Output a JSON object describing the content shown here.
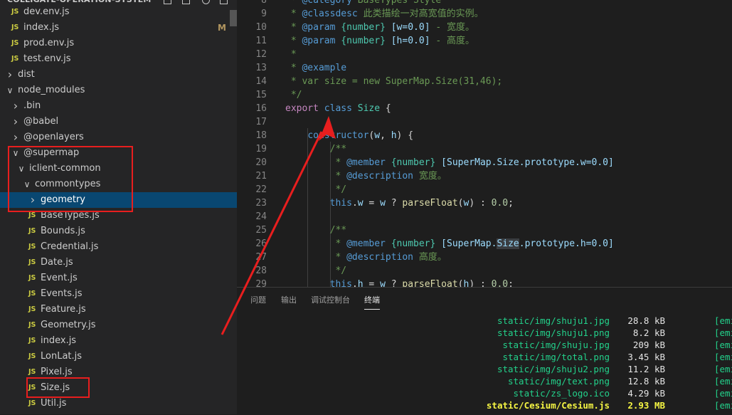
{
  "sidebar": {
    "title": "COLLIGATE-OPERATION-SYSTEM",
    "items": [
      {
        "label": "dev.env.js",
        "type": "file",
        "depth": 1
      },
      {
        "label": "index.js",
        "type": "file",
        "depth": 1,
        "badge": "M"
      },
      {
        "label": "prod.env.js",
        "type": "file",
        "depth": 1
      },
      {
        "label": "test.env.js",
        "type": "file",
        "depth": 1
      },
      {
        "label": "dist",
        "type": "folder",
        "depth": 0,
        "expanded": false
      },
      {
        "label": "node_modules",
        "type": "folder",
        "depth": 0,
        "expanded": true
      },
      {
        "label": ".bin",
        "type": "folder",
        "depth": 1,
        "expanded": false
      },
      {
        "label": "@babel",
        "type": "folder",
        "depth": 1,
        "expanded": false
      },
      {
        "label": "@openlayers",
        "type": "folder",
        "depth": 1,
        "expanded": false
      },
      {
        "label": "@supermap",
        "type": "folder",
        "depth": 1,
        "expanded": true
      },
      {
        "label": "iclient-common",
        "type": "folder",
        "depth": 2,
        "expanded": true
      },
      {
        "label": "commontypes",
        "type": "folder",
        "depth": 3,
        "expanded": true
      },
      {
        "label": "geometry",
        "type": "folder",
        "depth": 4,
        "expanded": false,
        "selected": true
      },
      {
        "label": "BaseTypes.js",
        "type": "file",
        "depth": 4
      },
      {
        "label": "Bounds.js",
        "type": "file",
        "depth": 4
      },
      {
        "label": "Credential.js",
        "type": "file",
        "depth": 4
      },
      {
        "label": "Date.js",
        "type": "file",
        "depth": 4
      },
      {
        "label": "Event.js",
        "type": "file",
        "depth": 4
      },
      {
        "label": "Events.js",
        "type": "file",
        "depth": 4
      },
      {
        "label": "Feature.js",
        "type": "file",
        "depth": 4
      },
      {
        "label": "Geometry.js",
        "type": "file",
        "depth": 4
      },
      {
        "label": "index.js",
        "type": "file",
        "depth": 4
      },
      {
        "label": "LonLat.js",
        "type": "file",
        "depth": 4
      },
      {
        "label": "Pixel.js",
        "type": "file",
        "depth": 4
      },
      {
        "label": "Size.js",
        "type": "file",
        "depth": 4
      },
      {
        "label": "Util.js",
        "type": "file",
        "depth": 4
      }
    ]
  },
  "editor": {
    "lines": [
      {
        "n": "8",
        "tokens": [
          [
            " * ",
            "com"
          ],
          [
            "@category",
            "tag"
          ],
          [
            " BaseTypes Style",
            "com"
          ]
        ]
      },
      {
        "n": "9",
        "tokens": [
          [
            " * ",
            "com"
          ],
          [
            "@classdesc",
            "tag"
          ],
          [
            " 此类描绘一对高宽值的实例。",
            "com"
          ]
        ]
      },
      {
        "n": "10",
        "tokens": [
          [
            " * ",
            "com"
          ],
          [
            "@param",
            "tag"
          ],
          [
            " ",
            "com"
          ],
          [
            "{number}",
            "type"
          ],
          [
            " ",
            "com"
          ],
          [
            "[w=0.0]",
            "var"
          ],
          [
            " - 宽度。",
            "com"
          ]
        ]
      },
      {
        "n": "11",
        "tokens": [
          [
            " * ",
            "com"
          ],
          [
            "@param",
            "tag"
          ],
          [
            " ",
            "com"
          ],
          [
            "{number}",
            "type"
          ],
          [
            " ",
            "com"
          ],
          [
            "[h=0.0]",
            "var"
          ],
          [
            " - 高度。",
            "com"
          ]
        ]
      },
      {
        "n": "12",
        "tokens": [
          [
            " *",
            "com"
          ]
        ]
      },
      {
        "n": "13",
        "tokens": [
          [
            " * ",
            "com"
          ],
          [
            "@example",
            "tag"
          ]
        ]
      },
      {
        "n": "14",
        "tokens": [
          [
            " * var size = new SuperMap.Size(31,46);",
            "com"
          ]
        ]
      },
      {
        "n": "15",
        "tokens": [
          [
            " */",
            "com"
          ]
        ]
      },
      {
        "n": "16",
        "tokens": [
          [
            "export",
            "kw"
          ],
          [
            " ",
            "plain"
          ],
          [
            "class",
            "tag"
          ],
          [
            " ",
            "plain"
          ],
          [
            "Size",
            "class"
          ],
          [
            " {",
            "plain"
          ]
        ]
      },
      {
        "n": "17",
        "tokens": []
      },
      {
        "n": "18",
        "tokens": [
          [
            "    ",
            "plain"
          ],
          [
            "constructor",
            "tag"
          ],
          [
            "(",
            "plain"
          ],
          [
            "w",
            "var"
          ],
          [
            ", ",
            "plain"
          ],
          [
            "h",
            "var"
          ],
          [
            ") {",
            "plain"
          ]
        ]
      },
      {
        "n": "19",
        "tokens": [
          [
            "        /**",
            "com"
          ]
        ]
      },
      {
        "n": "20",
        "tokens": [
          [
            "         * ",
            "com"
          ],
          [
            "@member",
            "tag"
          ],
          [
            " ",
            "com"
          ],
          [
            "{number}",
            "type"
          ],
          [
            " ",
            "com"
          ],
          [
            "[SuperMap.Size.prototype.w=0.0]",
            "var"
          ]
        ]
      },
      {
        "n": "21",
        "tokens": [
          [
            "         * ",
            "com"
          ],
          [
            "@description",
            "tag"
          ],
          [
            " 宽度。",
            "com"
          ]
        ]
      },
      {
        "n": "22",
        "tokens": [
          [
            "         */",
            "com"
          ]
        ]
      },
      {
        "n": "23",
        "tokens": [
          [
            "        ",
            "plain"
          ],
          [
            "this",
            "tag"
          ],
          [
            ".",
            "plain"
          ],
          [
            "w",
            "var"
          ],
          [
            " = ",
            "plain"
          ],
          [
            "w",
            "var"
          ],
          [
            " ? ",
            "plain"
          ],
          [
            "parseFloat",
            "fn"
          ],
          [
            "(",
            "plain"
          ],
          [
            "w",
            "var"
          ],
          [
            ") : ",
            "plain"
          ],
          [
            "0.0",
            "num"
          ],
          [
            ";",
            "plain"
          ]
        ]
      },
      {
        "n": "24",
        "tokens": []
      },
      {
        "n": "25",
        "tokens": [
          [
            "        /**",
            "com"
          ]
        ]
      },
      {
        "n": "26",
        "tokens": [
          [
            "         * ",
            "com"
          ],
          [
            "@member",
            "tag"
          ],
          [
            " ",
            "com"
          ],
          [
            "{number}",
            "type"
          ],
          [
            " ",
            "com"
          ],
          [
            "[SuperMap.",
            "var"
          ],
          [
            "Size",
            "var-hl"
          ],
          [
            ".prototype.h=0.0]",
            "var"
          ]
        ]
      },
      {
        "n": "27",
        "tokens": [
          [
            "         * ",
            "com"
          ],
          [
            "@description",
            "tag"
          ],
          [
            " 高度。",
            "com"
          ]
        ]
      },
      {
        "n": "28",
        "tokens": [
          [
            "         */",
            "com"
          ]
        ]
      },
      {
        "n": "29",
        "tokens": [
          [
            "        ",
            "plain"
          ],
          [
            "this",
            "tag"
          ],
          [
            ".",
            "plain"
          ],
          [
            "h",
            "var"
          ],
          [
            " = ",
            "plain"
          ],
          [
            "w",
            "var"
          ],
          [
            " ? ",
            "plain"
          ],
          [
            "parseFloat",
            "fn"
          ],
          [
            "(",
            "plain"
          ],
          [
            "h",
            "var"
          ],
          [
            ") : ",
            "plain"
          ],
          [
            "0.0",
            "num"
          ],
          [
            ";",
            "plain"
          ]
        ]
      }
    ]
  },
  "panel": {
    "tabs": [
      {
        "label": "问题",
        "active": false
      },
      {
        "label": "输出",
        "active": false
      },
      {
        "label": "调试控制台",
        "active": false
      },
      {
        "label": "终端",
        "active": true
      }
    ],
    "rows": [
      {
        "file": "static/img/shuju1.jpg",
        "size": "28.8 kB",
        "emit": "[emi",
        "big": false
      },
      {
        "file": "static/img/shuju1.png",
        "size": "8.2 kB",
        "emit": "[emi",
        "big": false
      },
      {
        "file": "static/img/shuju.jpg",
        "size": "209 kB",
        "emit": "[emi",
        "big": false
      },
      {
        "file": "static/img/total.png",
        "size": "3.45 kB",
        "emit": "[emi",
        "big": false
      },
      {
        "file": "static/img/shuju2.png",
        "size": "11.2 kB",
        "emit": "[emi",
        "big": false
      },
      {
        "file": "static/img/text.png",
        "size": "12.8 kB",
        "emit": "[emi",
        "big": false
      },
      {
        "file": "static/zs_logo.ico",
        "size": "4.29 kB",
        "emit": "[emi",
        "big": false
      },
      {
        "file": "static/Cesium/Cesium.js",
        "size": "2.93 MB",
        "emit": "[emi",
        "big": true
      }
    ]
  },
  "colors": {
    "accent_selection": "#094771",
    "annotation_red": "#e81e1e",
    "js_icon": "#cbcb41",
    "terminal_green": "#23d18b",
    "terminal_yellow": "#f5f543"
  },
  "icons": [
    "chevron-right-icon",
    "chevron-down-icon",
    "js-file-icon",
    "new-file-icon",
    "new-folder-icon",
    "refresh-icon",
    "collapse-icon"
  ]
}
